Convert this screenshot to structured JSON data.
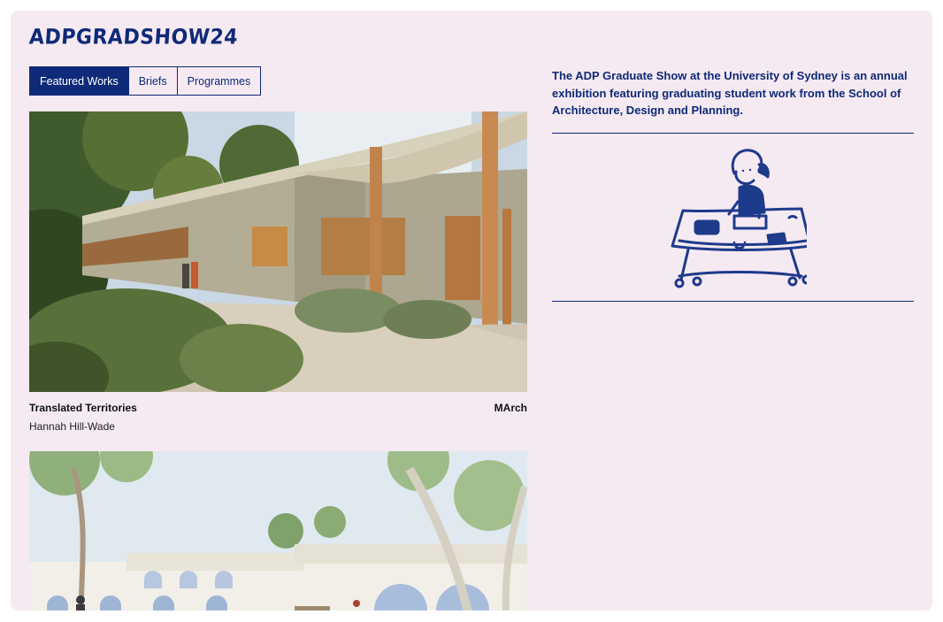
{
  "site": {
    "logo": "ADPGRADSHOW24"
  },
  "tabs": [
    {
      "label": "Featured Works",
      "active": true
    },
    {
      "label": "Briefs",
      "active": false
    },
    {
      "label": "Programmes",
      "active": false
    }
  ],
  "intro": {
    "text": "The ADP Graduate Show at the University of Sydney is an annual exhibition featuring graduating student work from the School of Architecture, Design and Planning."
  },
  "works": [
    {
      "title": "Translated Territories",
      "author": "Hannah Hill-Wade",
      "program": "MArch"
    },
    {
      "title": "",
      "author": "",
      "program": ""
    }
  ],
  "colors": {
    "accent": "#0f2a78",
    "background": "#f5e9f2"
  },
  "icons": {
    "illustration": "person-at-desk-illustration"
  }
}
